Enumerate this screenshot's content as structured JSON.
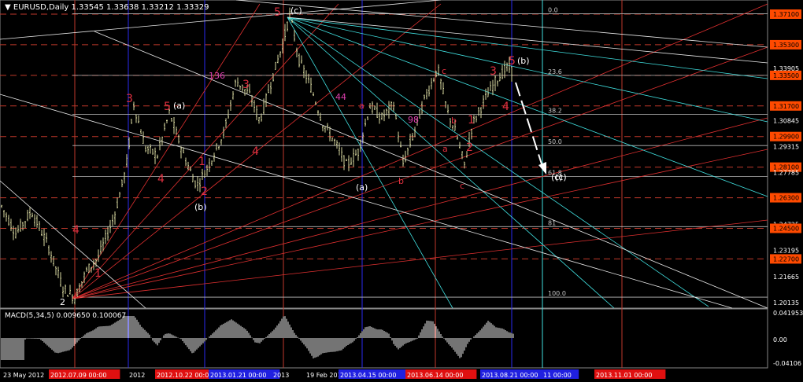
{
  "header": {
    "symbol": "EURUSD,Daily",
    "ohlc": "1.33545 1.33638 1.33212 1.33329"
  },
  "macd_header": "MACD(5,34,5) 0.009650 0.100067",
  "colors": {
    "background": "#000000",
    "candle": "#d8d8a0",
    "grid_red": "#c0392b",
    "grid_blue": "#2a2af0",
    "cyan": "#40e0e0",
    "red_fan": "#e03030",
    "white": "#e8e8e8",
    "price_box": "#ff4a00",
    "fib_label": "#c8c8c8"
  },
  "chart_data": {
    "type": "candlestick",
    "title": "EURUSD,Daily",
    "ylim": [
      1.19,
      1.385
    ],
    "price_axis_labels": [
      "1.37100",
      "1.35300",
      "1.33905",
      "1.33500",
      "1.31700",
      "1.30845",
      "1.29900",
      "1.29315",
      "1.28100",
      "1.27785",
      "1.26300",
      "1.24725",
      "1.24500",
      "1.23195",
      "1.22700",
      "1.21665",
      "1.20135"
    ],
    "highlighted_levels": [
      "1.37100",
      "1.35300",
      "1.33500",
      "1.31700",
      "1.29900",
      "1.28100",
      "1.26300",
      "1.24500",
      "1.22700"
    ],
    "fib_levels": [
      {
        "label": "0.0",
        "price": 1.3712
      },
      {
        "label": "23.6",
        "price": 1.335
      },
      {
        "label": "38.2",
        "price": 1.312
      },
      {
        "label": "50.0",
        "price": 1.2937
      },
      {
        "label": "61.8",
        "price": 1.2755
      },
      {
        "label": "81",
        "price": 1.246
      },
      {
        "label": "100.0",
        "price": 1.2045
      }
    ],
    "wave_labels": [
      "5",
      "(c)",
      "136",
      "3",
      "5",
      "(a)",
      "4",
      "1",
      "2",
      "(b)",
      "4",
      "3",
      "4",
      "1",
      "2",
      "(c)",
      "44",
      "a",
      "(a)",
      "98",
      "b",
      "c",
      "a",
      "b",
      "1",
      "c",
      "2",
      "3",
      "5",
      "(b)",
      "4",
      "(c)"
    ],
    "macd": {
      "name": "MACD(5,34,5)",
      "value": 0.00965,
      "signal": 0.100067,
      "axis_labels": [
        "0.041953",
        "0.00",
        "-0.04106"
      ]
    },
    "time_labels": [
      "23 May 2012",
      "2012.07.09 00:00",
      "2012",
      "2012.10.22 00:00",
      "2013.01.21 00:00",
      "2013",
      "19 Feb 2013",
      "2013.04.15 00:00",
      "2013.06.14 00:00",
      "2013.08.21 00:00",
      "11 00:00",
      "2013.11.01 00:00"
    ]
  }
}
